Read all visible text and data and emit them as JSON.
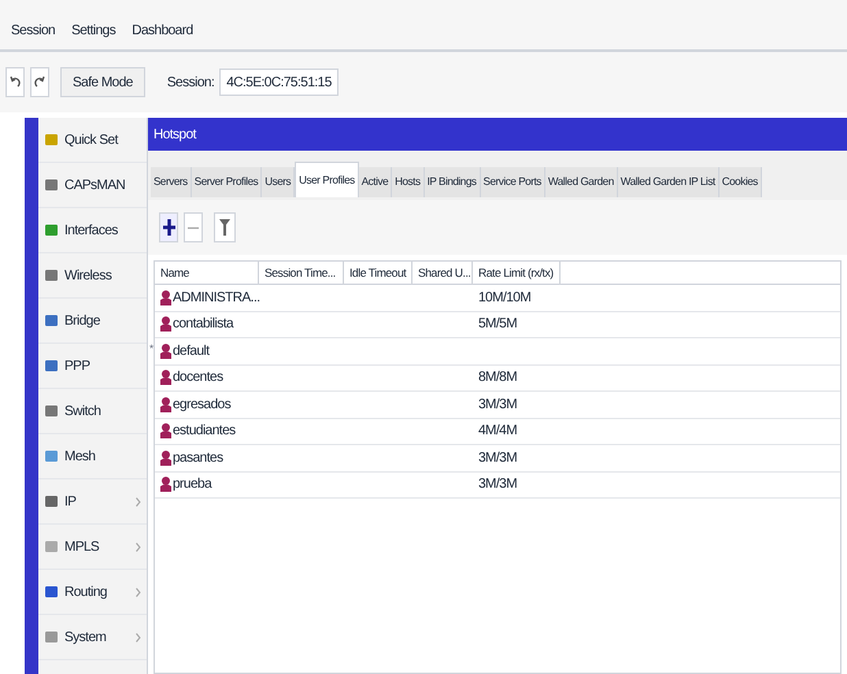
{
  "menu": [
    "Session",
    "Settings",
    "Dashboard"
  ],
  "toolbar": {
    "safe_mode": "Safe Mode",
    "session_label": "Session:",
    "session_value": "4C:5E:0C:75:51:15"
  },
  "sidebar": {
    "items": [
      {
        "label": "Quick Set",
        "has_submenu": false
      },
      {
        "label": "CAPsMAN",
        "has_submenu": false
      },
      {
        "label": "Interfaces",
        "has_submenu": false
      },
      {
        "label": "Wireless",
        "has_submenu": false
      },
      {
        "label": "Bridge",
        "has_submenu": false
      },
      {
        "label": "PPP",
        "has_submenu": false
      },
      {
        "label": "Switch",
        "has_submenu": false
      },
      {
        "label": "Mesh",
        "has_submenu": false
      },
      {
        "label": "IP",
        "has_submenu": true
      },
      {
        "label": "MPLS",
        "has_submenu": true
      },
      {
        "label": "Routing",
        "has_submenu": true
      },
      {
        "label": "System",
        "has_submenu": true
      }
    ]
  },
  "window": {
    "title": "Hotspot"
  },
  "tabs": [
    {
      "label": "Servers",
      "selected": false
    },
    {
      "label": "Server Profiles",
      "selected": false
    },
    {
      "label": "Users",
      "selected": false
    },
    {
      "label": "User Profiles",
      "selected": true
    },
    {
      "label": "Active",
      "selected": false
    },
    {
      "label": "Hosts",
      "selected": false
    },
    {
      "label": "IP Bindings",
      "selected": false
    },
    {
      "label": "Service Ports",
      "selected": false
    },
    {
      "label": "Walled Garden",
      "selected": false
    },
    {
      "label": "Walled Garden IP List",
      "selected": false
    },
    {
      "label": "Cookies",
      "selected": false
    }
  ],
  "table": {
    "columns": [
      "Name",
      "Session Time...",
      "Idle Timeout",
      "Shared U...",
      "Rate Limit (rx/tx)"
    ],
    "rows": [
      {
        "default_mark": "",
        "name": "ADMINISTRA...",
        "rate_limit": "10M/10M"
      },
      {
        "default_mark": "",
        "name": "contabilista",
        "rate_limit": "5M/5M"
      },
      {
        "default_mark": "*",
        "name": "default",
        "rate_limit": ""
      },
      {
        "default_mark": "",
        "name": "docentes",
        "rate_limit": "8M/8M"
      },
      {
        "default_mark": "",
        "name": "egresados",
        "rate_limit": "3M/3M"
      },
      {
        "default_mark": "",
        "name": "estudiantes",
        "rate_limit": "4M/4M"
      },
      {
        "default_mark": "",
        "name": "pasantes",
        "rate_limit": "3M/3M"
      },
      {
        "default_mark": "",
        "name": "prueba",
        "rate_limit": "3M/3M"
      }
    ]
  }
}
